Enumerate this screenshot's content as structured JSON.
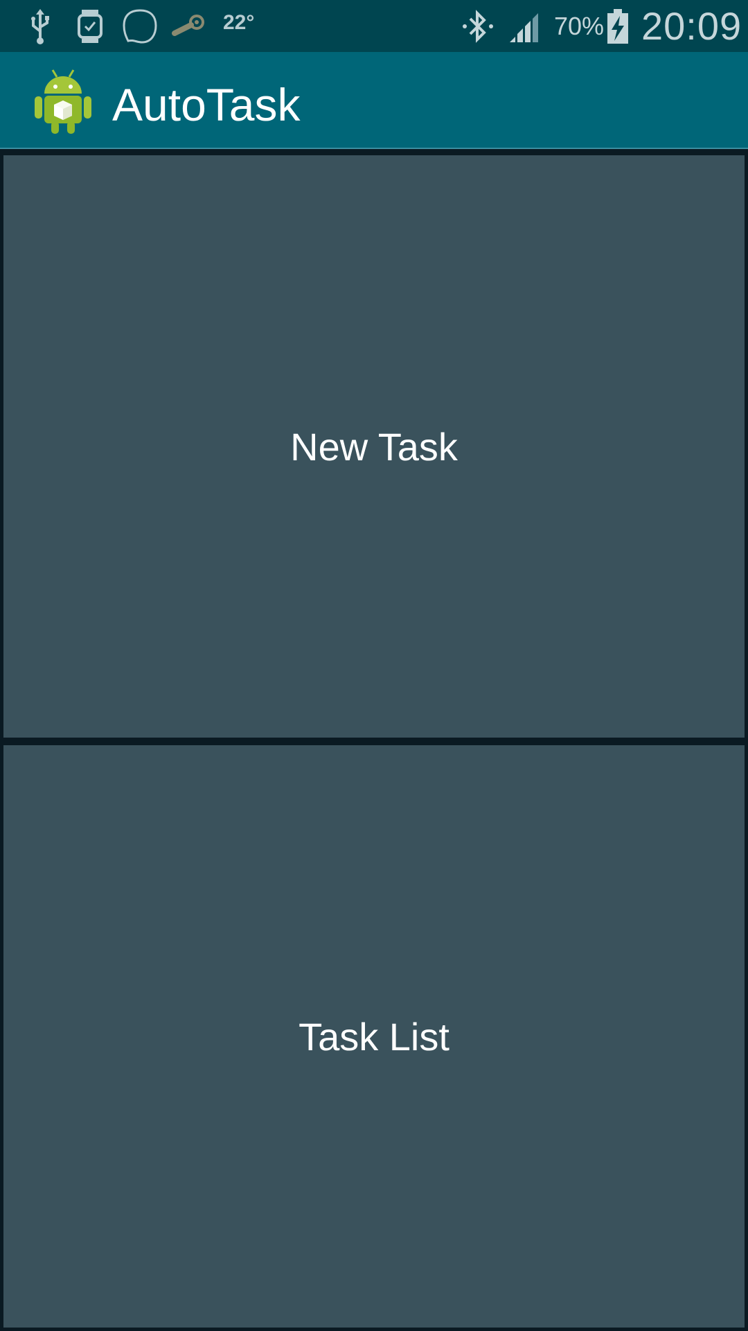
{
  "status_bar": {
    "icons": [
      "usb-icon",
      "smartwatch-icon",
      "chat-bubble-icon",
      "steam-icon",
      "bluetooth-icon",
      "signal-icon",
      "battery-charging-icon"
    ],
    "temperature": "22°",
    "battery_percent": "70%",
    "time": "20:09"
  },
  "action_bar": {
    "app_icon": "android-robot-icon",
    "title": "AutoTask"
  },
  "main": {
    "tiles": [
      {
        "label": "New Task"
      },
      {
        "label": "Task List"
      }
    ]
  },
  "colors": {
    "status_bar": "#004550",
    "action_bar": "#006678",
    "tile": "#3a525c",
    "background": "#0a1a22"
  }
}
